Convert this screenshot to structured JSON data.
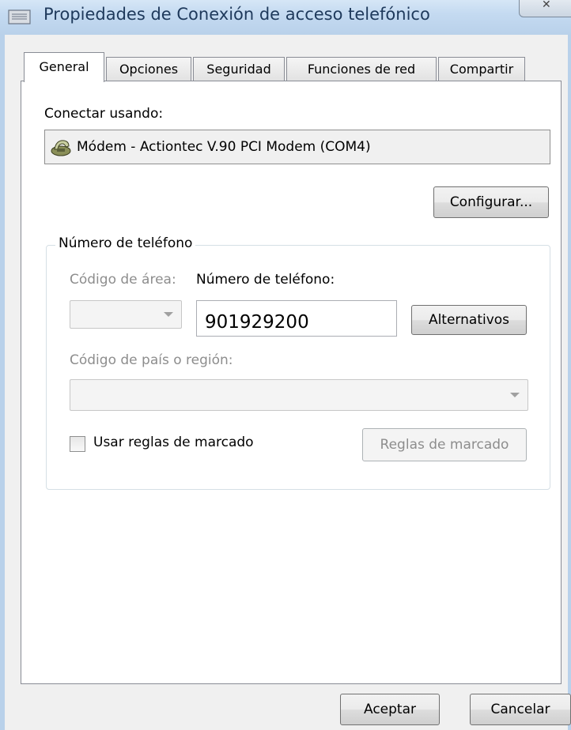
{
  "window": {
    "title": "Propiedades de Conexión de acceso telefónico",
    "close_glyph": "✕",
    "title_icon": "dialup-connection-icon"
  },
  "tabs": [
    {
      "label": "General",
      "active": true
    },
    {
      "label": "Opciones",
      "active": false
    },
    {
      "label": "Seguridad",
      "active": false
    },
    {
      "label": "Funciones de red",
      "active": false
    },
    {
      "label": "Compartir",
      "active": false
    }
  ],
  "general": {
    "connect_using_label": "Conectar usando:",
    "device": {
      "name": "Módem - Actiontec V.90 PCI Modem (COM4)",
      "icon": "modem-icon"
    },
    "configure_button": "Configurar...",
    "phone_group": {
      "title": "Número de teléfono",
      "area_code_label": "Código de área:",
      "area_code_value": "",
      "phone_number_label": "Número de teléfono:",
      "phone_number_value": "901929200",
      "alternates_button": "Alternativos",
      "country_label": "Código de país o región:",
      "country_value": "",
      "use_dialing_rules_label": "Usar reglas de marcado",
      "use_dialing_rules_checked": false,
      "dialing_rules_button": "Reglas de marcado"
    }
  },
  "footer": {
    "ok_button": "Aceptar",
    "cancel_button": "Cancelar"
  },
  "colors": {
    "titlebar": "#c4daf1",
    "title_text": "#1e395b",
    "disabled_text": "#8d8d8d"
  }
}
